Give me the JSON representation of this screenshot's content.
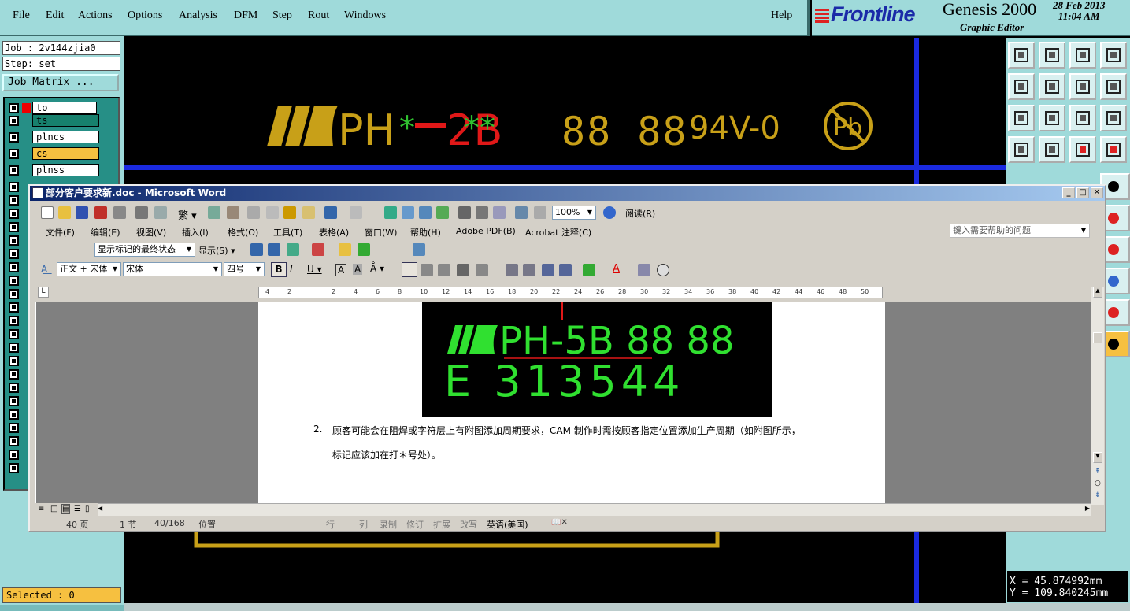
{
  "menu": {
    "items": [
      "File",
      "Edit",
      "Actions",
      "Options",
      "Analysis",
      "DFM",
      "Step",
      "Rout",
      "Windows"
    ],
    "help": "Help"
  },
  "brand": {
    "logo": "Frontline",
    "title": "Genesis 2000",
    "subtitle": "Graphic Editor",
    "date": "28 Feb 2013",
    "time": "11:04 AM"
  },
  "job": {
    "job_label": "Job : 2v144zjia0",
    "step_label": "Step: set",
    "matrix_button": "Job Matrix ..."
  },
  "layers": [
    {
      "name": "to",
      "color": "#ffffff"
    },
    {
      "name": "ts",
      "color": "#17806d"
    },
    {
      "name": "plncs",
      "color": "#ffffff"
    },
    {
      "name": "cs",
      "color": "#f6c040"
    },
    {
      "name": "plnss",
      "color": "#ffffff"
    }
  ],
  "selected": "Selected : 0",
  "canvas": {
    "text_main": "PH",
    "text_code": "2B",
    "text_date": "88 88",
    "text_rating": "94V-0",
    "text_pb": "Pb"
  },
  "coords": {
    "x": "X  =  45.874992mm",
    "y": "Y  = 109.840245mm"
  },
  "word": {
    "title": "部分客户要求新.doc - Microsoft Word",
    "menus": [
      "文件(F)",
      "编辑(E)",
      "视图(V)",
      "插入(I)",
      "格式(O)",
      "工具(T)",
      "表格(A)",
      "窗口(W)",
      "帮助(H)",
      "Adobe PDF(B)",
      "Acrobat 注释(C)"
    ],
    "help_placeholder": "键入需要帮助的问题",
    "zoom": "100%",
    "read_label": "阅读(R)",
    "markup_state": "显示标记的最终状态",
    "show_label": "显示(S)",
    "style": "正文 + 宋体",
    "font": "宋体",
    "size": "四号",
    "image_line1": "PH-5B 88 88",
    "image_line2": "E 313544",
    "para_num": "2.",
    "para_line1": "顾客可能会在阻焊或字符层上有附图添加周期要求，CAM 制作时需按顾客指定位置添加生产周期（如附图所示，",
    "para_line2": "标记应该加在打＊号处）。",
    "status": {
      "page": "40 页",
      "section": "1 节",
      "pages": "40/168",
      "position": "位置",
      "line": "行",
      "col": "列",
      "rec": "录制",
      "rev": "修订",
      "ext": "扩展",
      "ovr": "改写",
      "lang": "英语(美国)"
    }
  }
}
